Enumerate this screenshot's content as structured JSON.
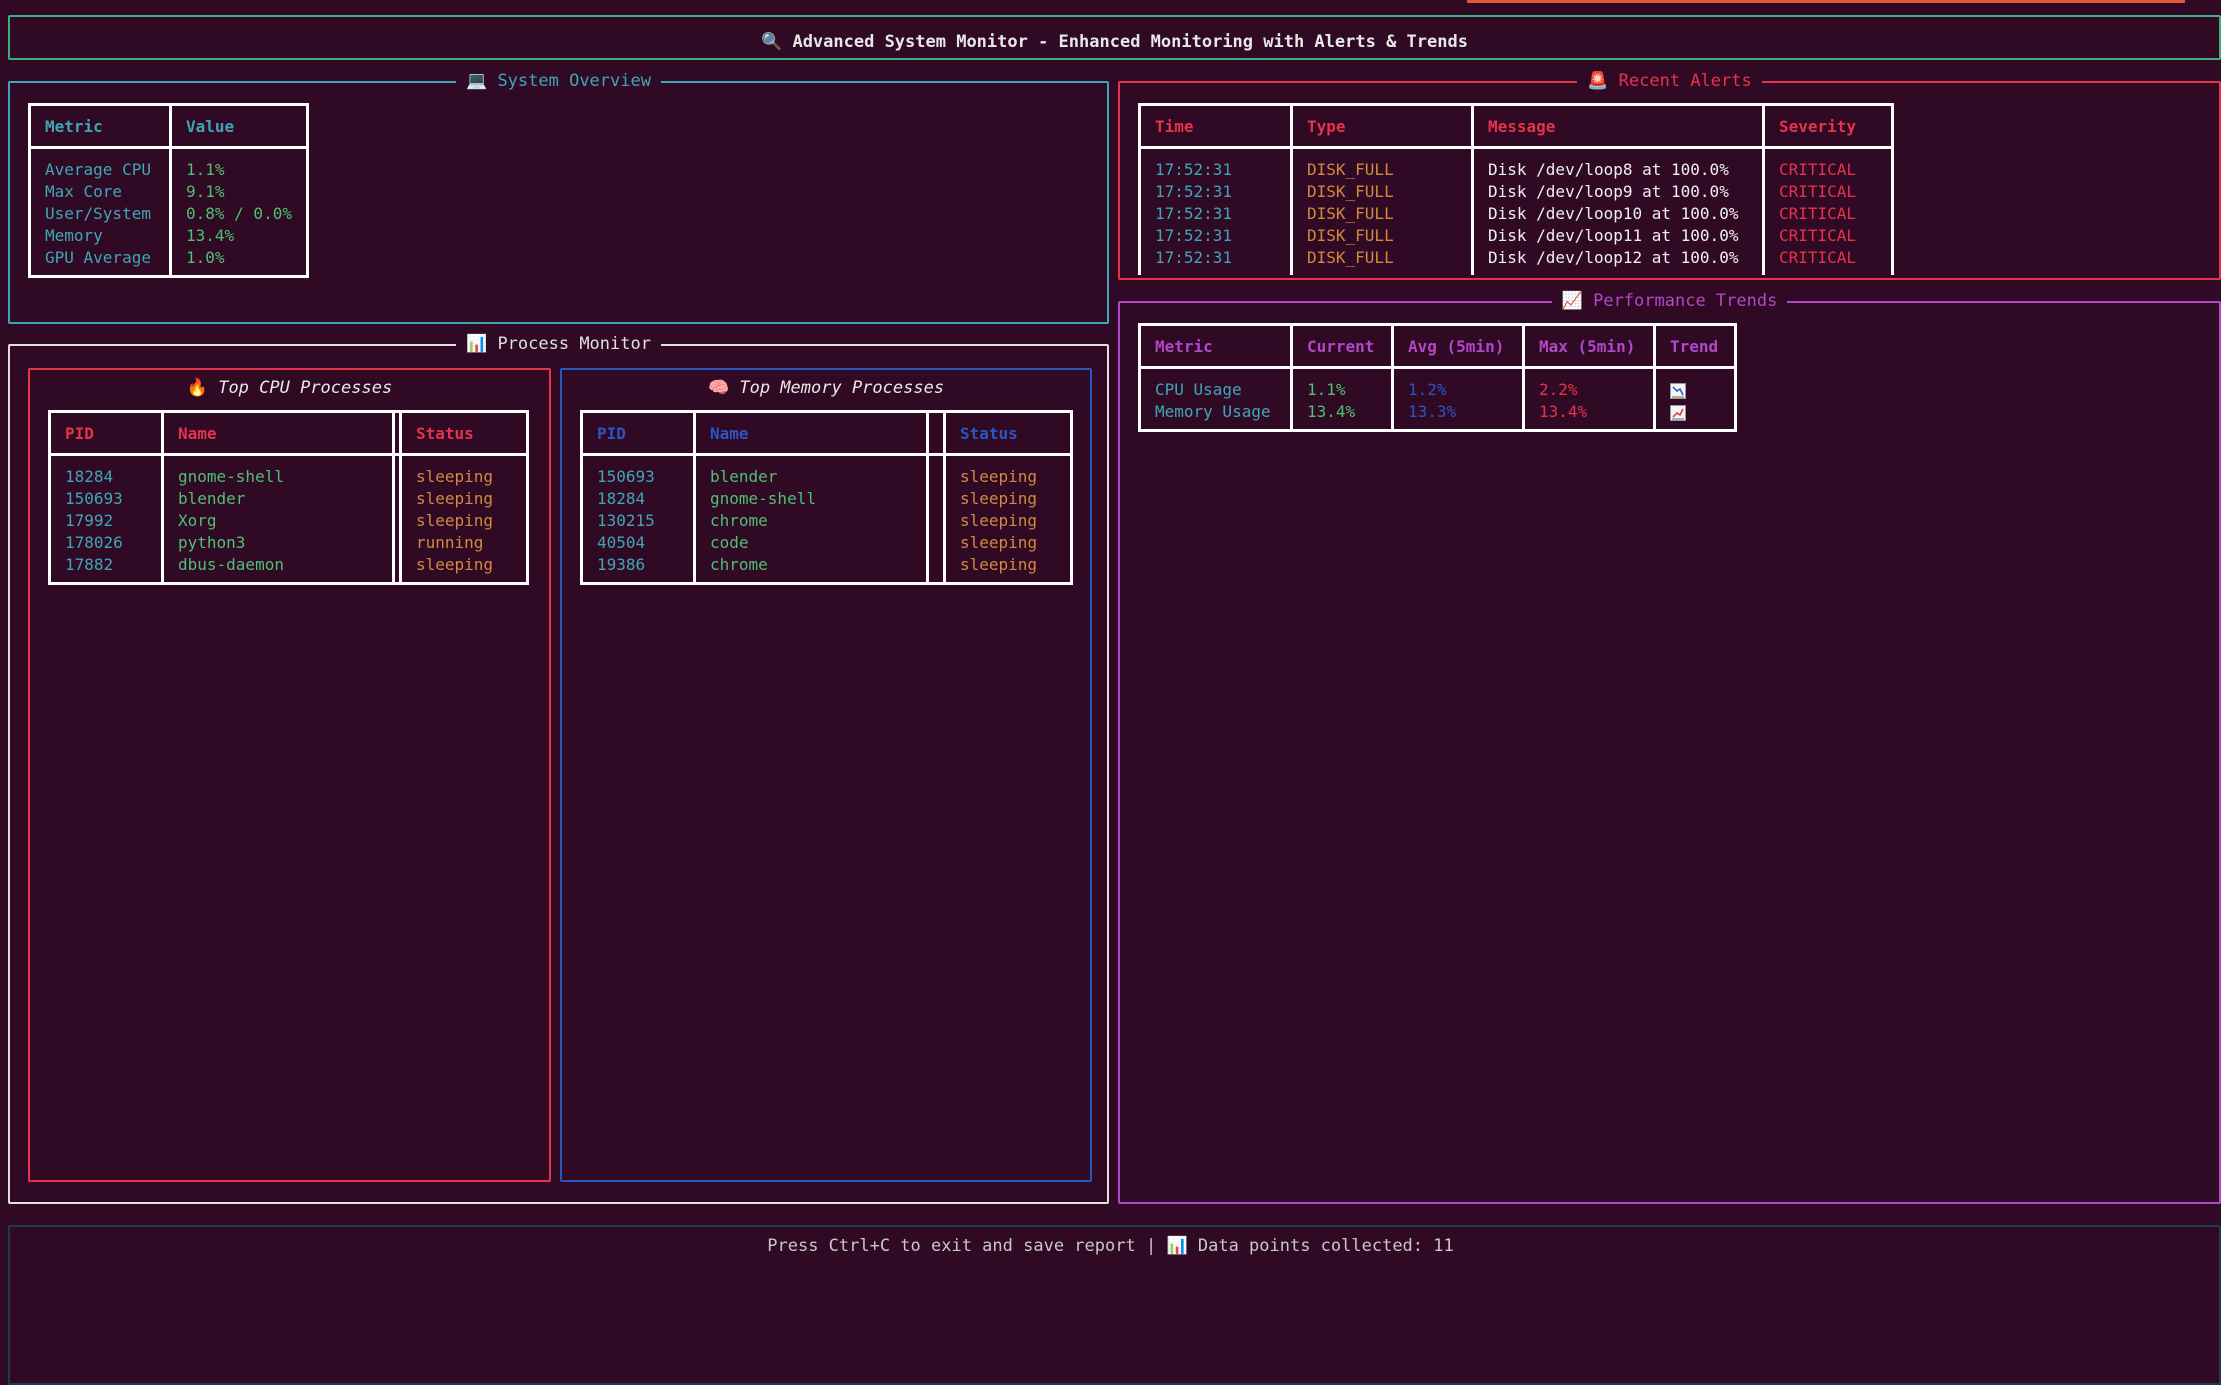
{
  "header": {
    "icon": "🔍",
    "title": "Advanced System Monitor - Enhanced Monitoring with Alerts & Trends"
  },
  "colors": {
    "background": "#300a24",
    "cyan": "#3ea6b8",
    "green": "#4fbf73",
    "red": "#e5334b",
    "orange": "#d2893c",
    "purple": "#b347c9",
    "blue": "#2a56c2"
  },
  "system_overview": {
    "icon": "💻",
    "title": "System Overview",
    "headers": [
      "Metric",
      "Value"
    ],
    "rows": [
      [
        "Average CPU",
        "1.1%"
      ],
      [
        "Max Core",
        "9.1%"
      ],
      [
        "User/System",
        "0.8% / 0.0%"
      ],
      [
        "Memory",
        "13.4%"
      ],
      [
        "GPU Average",
        "1.0%"
      ]
    ]
  },
  "alerts": {
    "icon": "🚨",
    "title": "Recent Alerts",
    "headers": [
      "Time",
      "Type",
      "Message",
      "Severity"
    ],
    "rows": [
      [
        "17:52:31",
        "DISK_FULL",
        "Disk /dev/loop8 at 100.0%",
        "CRITICAL"
      ],
      [
        "17:52:31",
        "DISK_FULL",
        "Disk /dev/loop9 at 100.0%",
        "CRITICAL"
      ],
      [
        "17:52:31",
        "DISK_FULL",
        "Disk /dev/loop10 at 100.0%",
        "CRITICAL"
      ],
      [
        "17:52:31",
        "DISK_FULL",
        "Disk /dev/loop11 at 100.0%",
        "CRITICAL"
      ],
      [
        "17:52:31",
        "DISK_FULL",
        "Disk /dev/loop12 at 100.0%",
        "CRITICAL"
      ]
    ]
  },
  "process_monitor": {
    "icon": "📊",
    "title": "Process Monitor",
    "cpu": {
      "icon": "🔥",
      "title": "Top CPU Processes",
      "headers": [
        "PID",
        "Name",
        "",
        "Status"
      ],
      "rows": [
        [
          "18284",
          "gnome-shell",
          "",
          "sleeping"
        ],
        [
          "150693",
          "blender",
          "",
          "sleeping"
        ],
        [
          "17992",
          "Xorg",
          "",
          "sleeping"
        ],
        [
          "178026",
          "python3",
          "",
          "running"
        ],
        [
          "17882",
          "dbus-daemon",
          "",
          "sleeping"
        ]
      ]
    },
    "memory": {
      "icon": "🧠",
      "title": "Top Memory Processes",
      "headers": [
        "PID",
        "Name",
        "",
        "Status"
      ],
      "rows": [
        [
          "150693",
          "blender",
          "",
          "sleeping"
        ],
        [
          "18284",
          "gnome-shell",
          "",
          "sleeping"
        ],
        [
          "130215",
          "chrome",
          "",
          "sleeping"
        ],
        [
          "40504",
          "code",
          "",
          "sleeping"
        ],
        [
          "19386",
          "chrome",
          "",
          "sleeping"
        ]
      ]
    }
  },
  "trends": {
    "icon": "📈",
    "title": "Performance Trends",
    "headers": [
      "Metric",
      "Current",
      "Avg (5min)",
      "Max (5min)",
      "Trend"
    ],
    "rows": [
      [
        "CPU Usage",
        "1.1%",
        "1.2%",
        "2.2%",
        "chart-decreasing-icon"
      ],
      [
        "Memory Usage",
        "13.4%",
        "13.3%",
        "13.4%",
        "chart-increasing-icon"
      ]
    ]
  },
  "footer": {
    "text_prefix": "Press Ctrl+C to exit and save report |",
    "icon": "📊",
    "text_suffix": "Data points collected: 11"
  }
}
